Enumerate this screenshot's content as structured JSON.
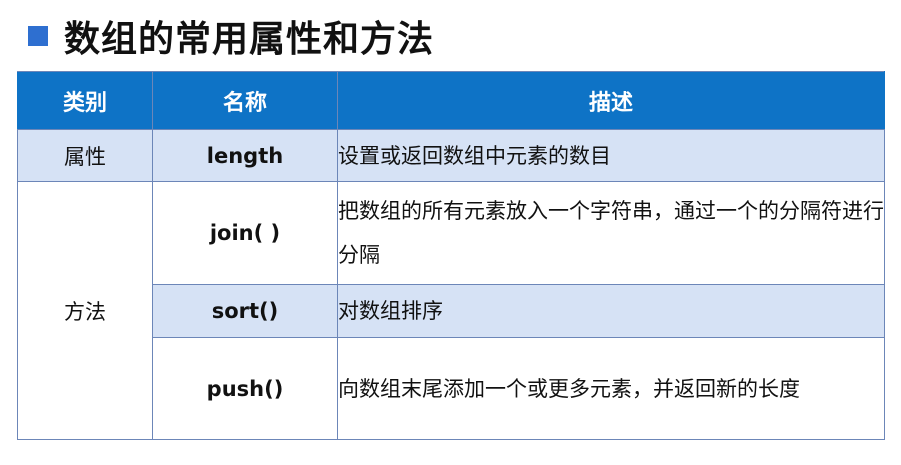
{
  "title": "数组的常用属性和方法",
  "table": {
    "headers": [
      "类别",
      "名称",
      "描述"
    ],
    "rows": [
      {
        "category": "属性",
        "name": "length",
        "description": "设置或返回数组中元素的数目"
      },
      {
        "category": "方法",
        "name": "join( )",
        "description": "把数组的所有元素放入一个字符串，通过一个的分隔符进行分隔"
      },
      {
        "name": "sort()",
        "description": "对数组排序"
      },
      {
        "name": "push()",
        "description": "向数组末尾添加一个或更多元素，并返回新的长度"
      }
    ]
  }
}
